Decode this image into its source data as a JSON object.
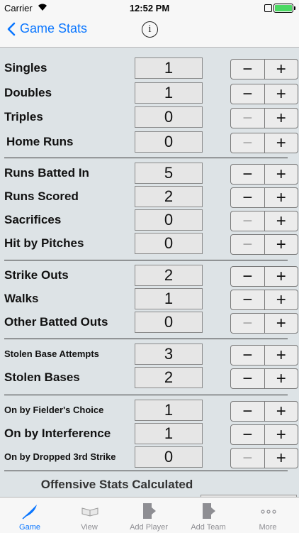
{
  "status_bar": {
    "carrier": "Carrier",
    "time": "12:52 PM"
  },
  "nav": {
    "back_label": "Game Stats",
    "info_symbol": "i"
  },
  "stats": [
    {
      "label": "Singles",
      "value": "1",
      "minus": "−",
      "plus": "+",
      "minus_enabled": true
    },
    {
      "label": "Doubles",
      "value": "1",
      "minus": "−",
      "plus": "+",
      "minus_enabled": true
    },
    {
      "label": "Triples",
      "value": "0",
      "minus": "−",
      "plus": "+",
      "minus_enabled": false
    },
    {
      "label": "Home Runs",
      "value": "0",
      "minus": "−",
      "plus": "+",
      "minus_enabled": false
    },
    {
      "label": "Runs Batted In",
      "value": "5",
      "minus": "−",
      "plus": "+",
      "minus_enabled": true
    },
    {
      "label": "Runs Scored",
      "value": "2",
      "minus": "−",
      "plus": "+",
      "minus_enabled": true
    },
    {
      "label": "Sacrifices",
      "value": "0",
      "minus": "−",
      "plus": "+",
      "minus_enabled": false
    },
    {
      "label": "Hit by Pitches",
      "value": "0",
      "minus": "−",
      "plus": "+",
      "minus_enabled": false
    },
    {
      "label": "Strike Outs",
      "value": "2",
      "minus": "−",
      "plus": "+",
      "minus_enabled": true
    },
    {
      "label": "Walks",
      "value": "1",
      "minus": "−",
      "plus": "+",
      "minus_enabled": true
    },
    {
      "label": "Other Batted Outs",
      "value": "0",
      "minus": "−",
      "plus": "+",
      "minus_enabled": false
    },
    {
      "label": "Stolen Base Attempts",
      "value": "3",
      "minus": "−",
      "plus": "+",
      "minus_enabled": true
    },
    {
      "label": "Stolen Bases",
      "value": "2",
      "minus": "−",
      "plus": "+",
      "minus_enabled": true
    },
    {
      "label": "On by Fielder's Choice",
      "value": "1",
      "minus": "−",
      "plus": "+",
      "minus_enabled": true
    },
    {
      "label": "On by Interference",
      "value": "1",
      "minus": "−",
      "plus": "+",
      "minus_enabled": true
    },
    {
      "label": "On by Dropped 3rd Strike",
      "value": "0",
      "minus": "−",
      "plus": "+",
      "minus_enabled": false
    }
  ],
  "section_footer": "Offensive Stats Calculated",
  "tabs": [
    {
      "label": "Game",
      "icon": "quill-icon",
      "active": true
    },
    {
      "label": "View",
      "icon": "book-icon",
      "active": false
    },
    {
      "label": "Add Player",
      "icon": "add-player-icon",
      "active": false
    },
    {
      "label": "Add Team",
      "icon": "add-team-icon",
      "active": false
    },
    {
      "label": "More",
      "icon": "more-icon",
      "active": false
    }
  ],
  "colors": {
    "accent": "#0a76ff",
    "panel_bg": "#dde3e6",
    "bar_bg": "#f7f7f7",
    "disabled": "#a8a8a8"
  }
}
